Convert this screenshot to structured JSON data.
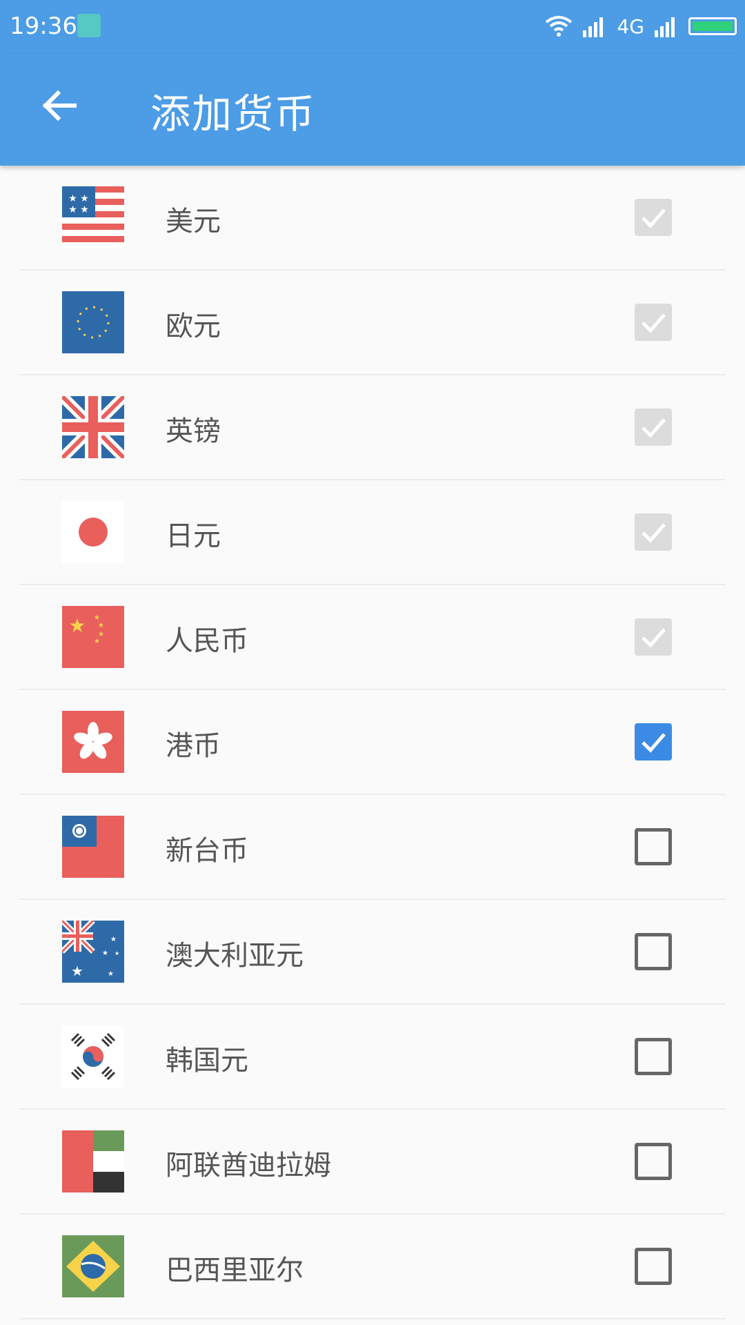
{
  "status_bar": {
    "time": "19:36",
    "network": "4G"
  },
  "app_bar": {
    "title": "添加货币"
  },
  "currencies": [
    {
      "name": "美元",
      "state": "disabled"
    },
    {
      "name": "欧元",
      "state": "disabled"
    },
    {
      "name": "英镑",
      "state": "disabled"
    },
    {
      "name": "日元",
      "state": "disabled"
    },
    {
      "name": "人民币",
      "state": "disabled"
    },
    {
      "name": "港币",
      "state": "checked"
    },
    {
      "name": "新台币",
      "state": "unchecked"
    },
    {
      "name": "澳大利亚元",
      "state": "unchecked"
    },
    {
      "name": "韩国元",
      "state": "unchecked"
    },
    {
      "name": "阿联酋迪拉姆",
      "state": "unchecked"
    },
    {
      "name": "巴西里亚尔",
      "state": "unchecked"
    }
  ],
  "colors": {
    "primary": "#4c9ce6",
    "checked": "#3b8be4",
    "disabled": "#dcdcdc"
  }
}
